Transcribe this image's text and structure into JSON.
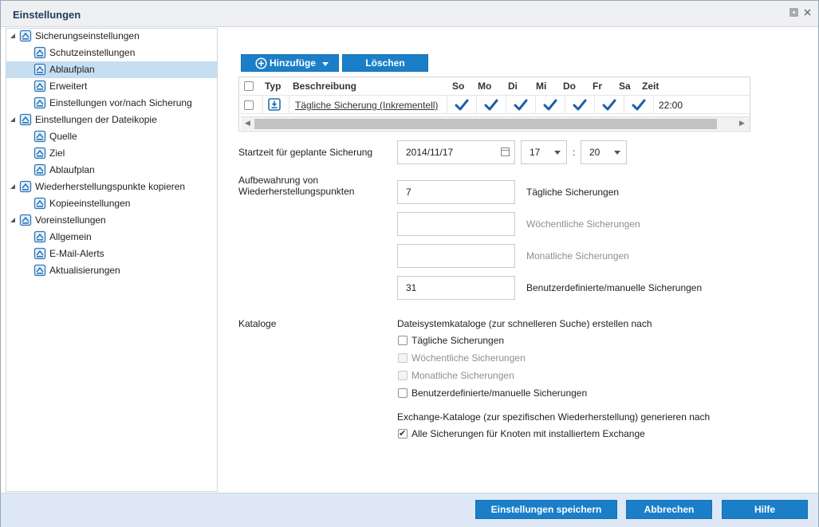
{
  "window": {
    "title": "Einstellungen"
  },
  "tree": [
    {
      "label": "Sicherungseinstellungen",
      "icon": "backup-settings-icon",
      "level": 0,
      "expanded": true
    },
    {
      "label": "Schutzeinstellungen",
      "icon": "protection-icon",
      "level": 1
    },
    {
      "label": "Ablaufplan",
      "icon": "schedule-icon",
      "level": 1,
      "selected": true
    },
    {
      "label": "Erweitert",
      "icon": "advanced-icon",
      "level": 1
    },
    {
      "label": "Einstellungen vor/nach Sicherung",
      "icon": "wrench-icon",
      "level": 1
    },
    {
      "label": "Einstellungen der Dateikopie",
      "icon": "filecopy-icon",
      "level": 0,
      "expanded": true
    },
    {
      "label": "Quelle",
      "icon": "source-icon",
      "level": 1
    },
    {
      "label": "Ziel",
      "icon": "destination-icon",
      "level": 1
    },
    {
      "label": "Ablaufplan",
      "icon": "schedule-icon",
      "level": 1
    },
    {
      "label": "Wiederherstellungspunkte kopieren",
      "icon": "copy-recovery-icon",
      "level": 0,
      "expanded": true
    },
    {
      "label": "Kopieeinstellungen",
      "icon": "copy-settings-icon",
      "level": 1
    },
    {
      "label": "Voreinstellungen",
      "icon": "preferences-icon",
      "level": 0,
      "expanded": true
    },
    {
      "label": "Allgemein",
      "icon": "general-icon",
      "level": 1
    },
    {
      "label": "E-Mail-Alerts",
      "icon": "email-icon",
      "level": 1
    },
    {
      "label": "Aktualisierungen",
      "icon": "updates-icon",
      "level": 1
    }
  ],
  "toolbar": {
    "add_label": "Hinzufüge",
    "delete_label": "Löschen"
  },
  "grid": {
    "headers": {
      "type": "Typ",
      "description": "Beschreibung",
      "days": [
        "So",
        "Mo",
        "Di",
        "Mi",
        "Do",
        "Fr",
        "Sa"
      ],
      "time": "Zeit"
    },
    "rows": [
      {
        "description": "Tägliche Sicherung (Inkrementell)",
        "days": [
          true,
          true,
          true,
          true,
          true,
          true,
          true
        ],
        "time": "22:00"
      }
    ]
  },
  "schedule": {
    "start_label": "Startzeit für geplante Sicherung",
    "date": "2014/11/17",
    "hour": "17",
    "separator": ":",
    "minute": "20"
  },
  "retention": {
    "label_line1": "Aufbewahrung von",
    "label_line2": "Wiederherstellungspunkten",
    "daily_value": "7",
    "daily_label": "Tägliche Sicherungen",
    "weekly_value": "",
    "weekly_label": "Wöchentliche Sicherungen",
    "monthly_value": "",
    "monthly_label": "Monatliche Sicherungen",
    "custom_value": "31",
    "custom_label": "Benutzerdefinierte/manuelle Sicherungen"
  },
  "catalogs": {
    "label": "Kataloge",
    "fs_heading": "Dateisystemkataloge (zur schnelleren Suche) erstellen nach",
    "fs_options": [
      {
        "label": "Tägliche Sicherungen",
        "checked": false,
        "disabled": false
      },
      {
        "label": "Wöchentliche Sicherungen",
        "checked": false,
        "disabled": true
      },
      {
        "label": "Monatliche Sicherungen",
        "checked": false,
        "disabled": true
      },
      {
        "label": "Benutzerdefinierte/manuelle Sicherungen",
        "checked": false,
        "disabled": false
      }
    ],
    "exchange_heading": "Exchange-Kataloge (zur spezifischen Wiederherstellung) generieren nach",
    "exchange_option": {
      "label": "Alle Sicherungen für Knoten mit installiertem Exchange",
      "checked": true
    }
  },
  "footer": {
    "save_label": "Einstellungen speichern",
    "cancel_label": "Abbrechen",
    "help_label": "Hilfe"
  },
  "colors": {
    "accent": "#1a7fc8",
    "selected": "#c6def0",
    "footer_bg": "#dfe8f6"
  }
}
